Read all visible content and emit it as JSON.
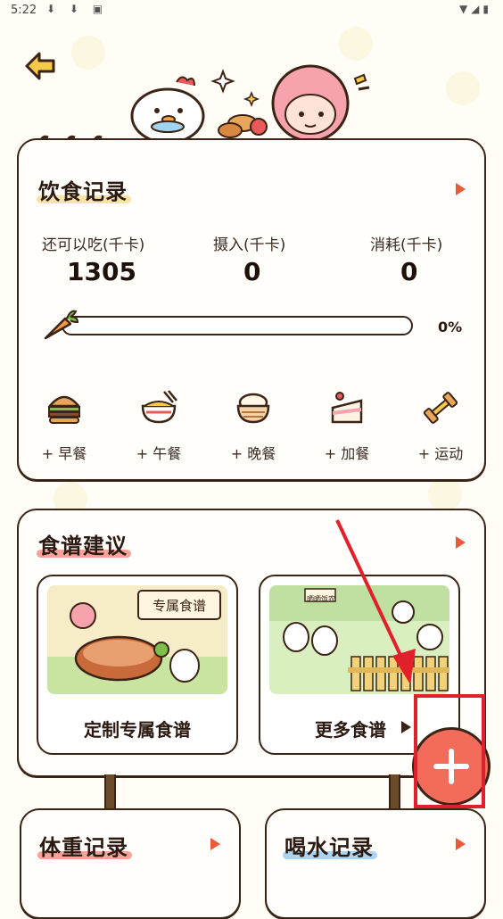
{
  "status_bar": {
    "time": "5:22",
    "notifications": "⬇ ⬇ ▣",
    "system": "▼◢▮"
  },
  "diet": {
    "title": "饮食记录",
    "remaining_label": "还可以吃(千卡)",
    "remaining_value": "1305",
    "intake_label": "摄入(千卡)",
    "intake_value": "0",
    "burn_label": "消耗(千卡)",
    "burn_value": "0",
    "progress_text": "0%",
    "progress": 0,
    "meals": [
      {
        "label": "+ 早餐",
        "icon": "burger-icon"
      },
      {
        "label": "+ 午餐",
        "icon": "noodle-bowl-icon"
      },
      {
        "label": "+ 晚餐",
        "icon": "rice-bowl-icon"
      },
      {
        "label": "+ 加餐",
        "icon": "cake-icon"
      },
      {
        "label": "+ 运动",
        "icon": "dumbbell-icon"
      }
    ]
  },
  "recipes": {
    "title": "食谱建议",
    "custom": {
      "caption": "定制专属食谱",
      "sign_text": "专属食谱"
    },
    "more": {
      "caption": "更多食谱",
      "sign_text": "晒晒饭农"
    }
  },
  "weight": {
    "title": "体重记录"
  },
  "water": {
    "title": "喝水记录"
  },
  "colors": {
    "accent": "#f26b5b",
    "highlight_red": "#f7a39a",
    "highlight_yellow": "#f9e2a8",
    "highlight_blue": "#a9d4f2",
    "annotation": "#e0202a"
  }
}
